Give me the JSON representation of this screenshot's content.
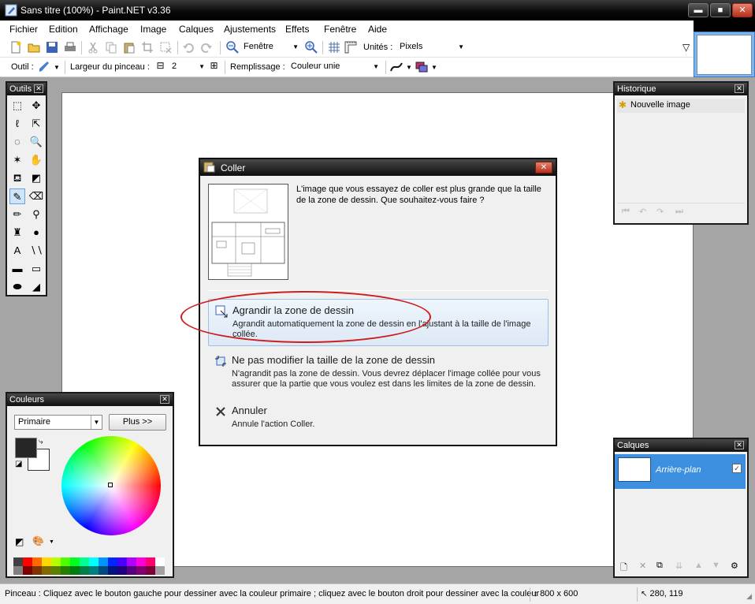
{
  "window": {
    "title": "Sans titre (100%) - Paint.NET v3.36",
    "app_icon": "paintnet-icon",
    "controls": {
      "minimize": "▬",
      "maximize": "■",
      "close": "✕"
    }
  },
  "menu": [
    "Fichier",
    "Edition",
    "Affichage",
    "Image",
    "Calques",
    "Ajustements",
    "Effets",
    "Fenêtre",
    "Aide"
  ],
  "toolbar": {
    "zoom_value": "Fenêtre",
    "units_label": "Unités :",
    "units_value": "Pixels"
  },
  "toolbar2": {
    "tool_label": "Outil :",
    "brush_width_label": "Largeur du pinceau :",
    "brush_width_value": "2",
    "minus": "⊟",
    "plus": "⊞",
    "fill_label": "Remplissage :",
    "fill_value": "Couleur unie"
  },
  "tools_panel": {
    "title": "Outils",
    "close": "✕",
    "tools": [
      {
        "name": "rectangle-select-icon",
        "glyph": "⬚"
      },
      {
        "name": "move-selection-icon",
        "glyph": "✥"
      },
      {
        "name": "lasso-select-icon",
        "glyph": "ℓ"
      },
      {
        "name": "move-pixels-icon",
        "glyph": "⇱"
      },
      {
        "name": "ellipse-select-icon",
        "glyph": "◌"
      },
      {
        "name": "zoom-icon",
        "glyph": "🔍"
      },
      {
        "name": "magic-wand-icon",
        "glyph": "✶"
      },
      {
        "name": "pan-hand-icon",
        "glyph": "✋"
      },
      {
        "name": "paint-bucket-icon",
        "glyph": "⛾"
      },
      {
        "name": "gradient-icon",
        "glyph": "◩"
      },
      {
        "name": "paintbrush-icon",
        "glyph": "✎"
      },
      {
        "name": "eraser-icon",
        "glyph": "⌫"
      },
      {
        "name": "pencil-icon",
        "glyph": "✏"
      },
      {
        "name": "color-picker-icon",
        "glyph": "⚲"
      },
      {
        "name": "clone-stamp-icon",
        "glyph": "♜"
      },
      {
        "name": "recolor-icon",
        "glyph": "●"
      },
      {
        "name": "text-icon",
        "glyph": "A"
      },
      {
        "name": "line-curve-icon",
        "glyph": "∖∖"
      },
      {
        "name": "rectangle-icon",
        "glyph": "▬"
      },
      {
        "name": "rounded-rectangle-icon",
        "glyph": "▭"
      },
      {
        "name": "ellipse-icon",
        "glyph": "⬬"
      },
      {
        "name": "freeform-shape-icon",
        "glyph": "◢"
      }
    ]
  },
  "colors_panel": {
    "title": "Couleurs",
    "close": "✕",
    "mode": "Primaire",
    "more_button": "Plus >>",
    "primary_color": "#262626",
    "secondary_color": "#ffffff",
    "palette": [
      "#404040",
      "#ff0000",
      "#ff6a00",
      "#ffd800",
      "#b6ff00",
      "#4cff00",
      "#00ff21",
      "#00ff90",
      "#00ffff",
      "#0094ff",
      "#0026ff",
      "#4800ff",
      "#b200ff",
      "#ff00dc",
      "#ff006e",
      "#ffffff",
      "#808080",
      "#7f0000",
      "#7f3300",
      "#7f6a00",
      "#5b7f00",
      "#267f00",
      "#007f0e",
      "#007f46",
      "#007f7f",
      "#004a7f",
      "#00137f",
      "#21007f",
      "#57007f",
      "#7f006e",
      "#7f0037",
      "#a0a0a0"
    ]
  },
  "history_panel": {
    "title": "Historique",
    "close": "✕",
    "items": [
      "Nouvelle image"
    ]
  },
  "layers_panel": {
    "title": "Calques",
    "close": "✕",
    "layers": [
      {
        "name": "Arrière-plan",
        "visible_mark": "✓"
      }
    ]
  },
  "dialog": {
    "title": "Coller",
    "close": "✕",
    "message": "L'image que vous essayez de coller est plus grande que la taille de la zone de dessin. Que souhaitez-vous faire ?",
    "options": [
      {
        "title": "Agrandir la zone de dessin",
        "desc": "Agrandit automatiquement la zone de dessin en l'ajustant à la taille de l'image collée."
      },
      {
        "title": "Ne pas modifier la taille de la zone de dessin",
        "desc": "N'agrandit pas la zone de dessin. Vous devrez déplacer l'image collée pour vous assurer que la partie que vous voulez est dans les limites de la zone de dessin."
      },
      {
        "title": "Annuler",
        "desc": "Annule l'action Coller."
      }
    ]
  },
  "status": {
    "hint": "Pinceau : Cliquez avec le bouton gauche pour dessiner avec la couleur primaire ; cliquez avec le bouton droit pour dessiner avec la couleur",
    "image_size": "800 x 600",
    "cursor_pos": "280, 119"
  }
}
